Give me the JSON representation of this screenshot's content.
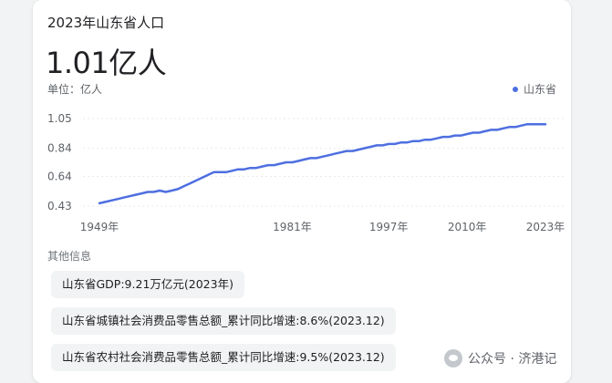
{
  "card": {
    "title": "2023年山东省人口",
    "big_value": "1.01亿人",
    "unit": "单位：亿人",
    "legend_label": "山东省",
    "other_info_title": "其他信息",
    "chips": [
      "山东省GDP:9.21万亿元(2023年)",
      "山东省城镇社会消费品零售总额_累计同比增速:8.6%(2023.12)",
      "山东省农村社会消费品零售总额_累计同比增速:9.5%(2023.12)"
    ]
  },
  "watermark": {
    "text": "公众号 · 济港记"
  },
  "colors": {
    "line": "#4e6fe0",
    "grid": "#e8eaed",
    "text": "#5f6368"
  },
  "chart_data": {
    "type": "line",
    "title": "2023年山东省人口",
    "ylabel": "单位：亿人",
    "ylim": [
      0.43,
      1.05
    ],
    "yticks": [
      "1.05",
      "0.84",
      "0.64",
      "0.43"
    ],
    "xticks": [
      "1949年",
      "1981年",
      "1997年",
      "2010年",
      "2023年"
    ],
    "series": [
      {
        "name": "山东省",
        "x": [
          1949,
          1950,
          1951,
          1952,
          1953,
          1954,
          1955,
          1956,
          1957,
          1958,
          1959,
          1960,
          1961,
          1962,
          1963,
          1964,
          1965,
          1966,
          1967,
          1968,
          1969,
          1970,
          1971,
          1972,
          1973,
          1974,
          1975,
          1976,
          1977,
          1978,
          1979,
          1980,
          1981,
          1982,
          1983,
          1984,
          1985,
          1986,
          1987,
          1988,
          1989,
          1990,
          1991,
          1992,
          1993,
          1994,
          1995,
          1996,
          1997,
          1998,
          1999,
          2000,
          2001,
          2002,
          2003,
          2004,
          2005,
          2006,
          2007,
          2008,
          2009,
          2010,
          2011,
          2012,
          2013,
          2014,
          2015,
          2016,
          2017,
          2018,
          2019,
          2020,
          2021,
          2022,
          2023
        ],
        "values": [
          0.45,
          0.46,
          0.47,
          0.48,
          0.49,
          0.5,
          0.51,
          0.52,
          0.53,
          0.53,
          0.54,
          0.53,
          0.54,
          0.55,
          0.57,
          0.59,
          0.61,
          0.63,
          0.65,
          0.67,
          0.67,
          0.67,
          0.68,
          0.69,
          0.69,
          0.7,
          0.7,
          0.71,
          0.72,
          0.72,
          0.73,
          0.74,
          0.74,
          0.75,
          0.76,
          0.77,
          0.77,
          0.78,
          0.79,
          0.8,
          0.81,
          0.82,
          0.82,
          0.83,
          0.84,
          0.85,
          0.86,
          0.86,
          0.87,
          0.87,
          0.88,
          0.88,
          0.89,
          0.89,
          0.9,
          0.9,
          0.91,
          0.92,
          0.92,
          0.93,
          0.93,
          0.94,
          0.95,
          0.95,
          0.96,
          0.97,
          0.97,
          0.98,
          0.99,
          0.99,
          1.0,
          1.01,
          1.01,
          1.01,
          1.01
        ]
      }
    ]
  }
}
